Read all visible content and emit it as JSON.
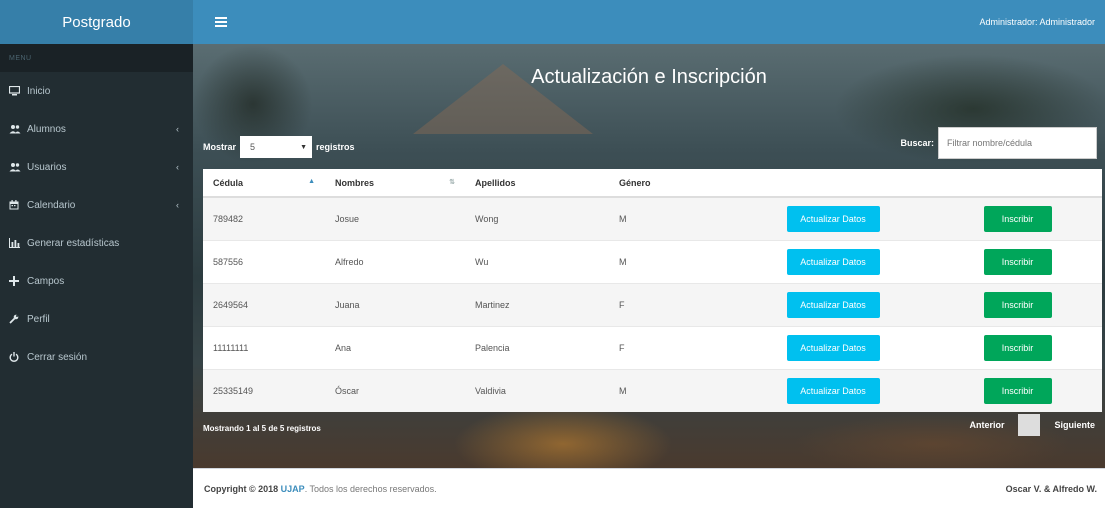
{
  "sidebar": {
    "logo": "Postgrado",
    "header": "MENU",
    "items": [
      {
        "label": "Inicio",
        "icon": "monitor-icon",
        "arrow": ""
      },
      {
        "label": "Alumnos",
        "icon": "users-icon",
        "arrow": "‹"
      },
      {
        "label": "Usuarios",
        "icon": "users-icon",
        "arrow": "‹"
      },
      {
        "label": "Calendario",
        "icon": "calendar-icon",
        "arrow": "‹"
      },
      {
        "label": "Generar estadísticas",
        "icon": "bar-chart-icon",
        "arrow": ""
      },
      {
        "label": "Campos",
        "icon": "plus-icon",
        "arrow": ""
      },
      {
        "label": "Perfil",
        "icon": "wrench-icon",
        "arrow": ""
      },
      {
        "label": "Cerrar sesión",
        "icon": "power-icon",
        "arrow": ""
      }
    ]
  },
  "topbar": {
    "user": "Administrador: Administrador"
  },
  "main": {
    "title": "Actualización e Inscripción",
    "show_label": "Mostrar",
    "length_value": "5",
    "records_label": "registros",
    "search_label": "Buscar:",
    "search_placeholder": "Filtrar nombre/cédula",
    "columns": [
      "Cédula",
      "Nombres",
      "Apellidos",
      "Género"
    ],
    "rows": [
      {
        "cedula": "789482",
        "nombres": "Josue",
        "apellidos": "Wong",
        "genero": "M"
      },
      {
        "cedula": "587556",
        "nombres": "Alfredo",
        "apellidos": "Wu",
        "genero": "M"
      },
      {
        "cedula": "2649564",
        "nombres": "Juana",
        "apellidos": "Martinez",
        "genero": "F"
      },
      {
        "cedula": "11111111",
        "nombres": "Ana",
        "apellidos": "Palencia",
        "genero": "F"
      },
      {
        "cedula": "25335149",
        "nombres": "Óscar",
        "apellidos": "Valdivia",
        "genero": "M"
      }
    ],
    "update_button": "Actualizar Datos",
    "enroll_button": "Inscribir",
    "info": "Mostrando 1 al 5 de 5 registros",
    "prev": "Anterior",
    "next": "Siguiente"
  },
  "footer": {
    "copyright": "Copyright © 2018",
    "org": "UJAP",
    "rights": ". Todos los derechos reservados.",
    "authors": "Oscar V. & Alfredo W."
  },
  "colors": {
    "sidebar": "#222d32",
    "topbar": "#3c8dbc",
    "logo": "#367fa9",
    "info_button": "#00c0ef",
    "success_button": "#00a65a"
  }
}
